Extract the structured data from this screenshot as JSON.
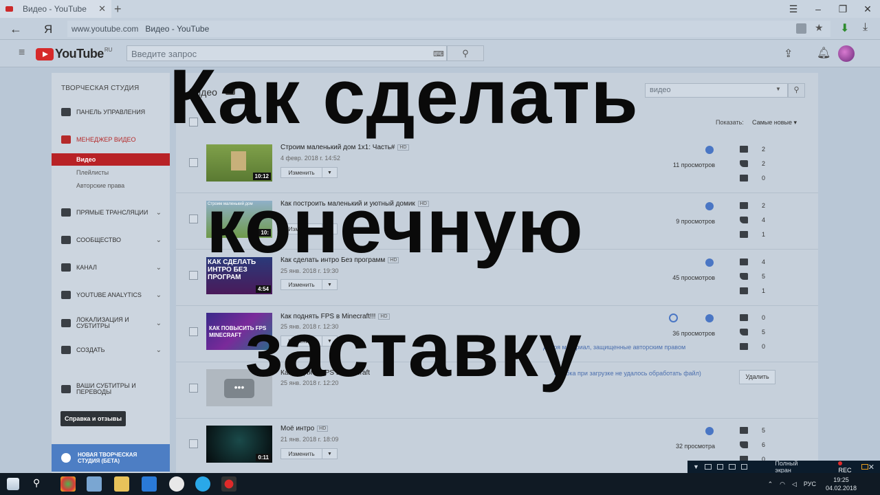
{
  "browser": {
    "tab_title": "Видео - YouTube",
    "url_host": "www.youtube.com",
    "url_title": "Видео - YouTube",
    "yandex_label": "Я"
  },
  "youtube": {
    "logo_text": "YouTube",
    "logo_region": "RU",
    "search_placeholder": "Введите запрос"
  },
  "sidebar": {
    "title": "ТВОРЧЕСКАЯ СТУДИЯ",
    "items": [
      {
        "label": "ПАНЕЛЬ УПРАВЛЕНИЯ"
      },
      {
        "label": "МЕНЕДЖЕР ВИДЕО"
      },
      {
        "label": "ПРЯМЫЕ ТРАНСЛЯЦИИ"
      },
      {
        "label": "СООБЩЕСТВО"
      },
      {
        "label": "КАНАЛ"
      },
      {
        "label": "YOUTUBE ANALYTICS"
      },
      {
        "label": "ЛОКАЛИЗАЦИЯ И СУБТИТРЫ"
      },
      {
        "label": "СОЗДАТЬ"
      },
      {
        "label": "ВАШИ СУБТИТРЫ И ПЕРЕВОДЫ"
      }
    ],
    "subitems": [
      "Видео",
      "Плейлисты",
      "Авторские права"
    ],
    "help_button": "Справка и отзывы",
    "new_studio": "НОВАЯ ТВОРЧЕСКАЯ СТУДИЯ (БЕТА)"
  },
  "main": {
    "title": "Видео",
    "count_badge": "9",
    "search_placeholder": "видео",
    "show_label": "Показать:",
    "sort_value": "Самые новые",
    "edit_label": "Изменить",
    "delete_label": "Удалить",
    "videos": [
      {
        "title": "Строим маленький дом 1х1: Часть#",
        "date": "4 февр. 2018 г. 14:52",
        "duration": "10:12",
        "views": "11 просмотров",
        "comments": "2",
        "likes": "2",
        "dislikes": "0"
      },
      {
        "title": "Как построить маленький и уютный домик",
        "date": "",
        "duration": "10:",
        "views": "9 просмотров",
        "comments": "2",
        "likes": "4",
        "dislikes": "1",
        "thumb_text": "Строим маленький дом"
      },
      {
        "title": "Как сделать интро Без программ",
        "date": "25 янв. 2018 г. 19:30",
        "duration": "4:54",
        "views": "45 просмотров",
        "comments": "4",
        "likes": "5",
        "dislikes": "1",
        "thumb_text": "КАК СДЕЛАТЬ ИНТРО БЕЗ ПРОГРАМ"
      },
      {
        "title": "Как поднять FPS в Minecraft!!!",
        "date": "25 янв. 2018 г. 12:30",
        "duration": "",
        "views": "36 просмотров",
        "comments": "0",
        "likes": "5",
        "dislikes": "0",
        "note": "деоря материал, защищенные авторским правом",
        "thumb_text": "КАК ПОВЫСИТЬ FPS MINECRAFT"
      },
      {
        "title": "Как поднять FPS в Minecraft",
        "date": "25 янв. 2018 г. 12:20",
        "duration": "",
        "views": "",
        "note": "ошибка при загрузке не удалось обработать файл)"
      },
      {
        "title": "Моё интро",
        "date": "21 янв. 2018 г. 18:09",
        "duration": "0:11",
        "views": "32 просмотра",
        "comments": "5",
        "likes": "6",
        "dislikes": "0"
      }
    ],
    "hd_label": "HD"
  },
  "overlay": {
    "line1": "Как сделать",
    "line2": "конечную",
    "line3": "заставку"
  },
  "recorder": {
    "fullscreen": "Полный экран",
    "rec": "REC"
  },
  "taskbar": {
    "lang": "РУС",
    "time": "19:25",
    "date": "04.02.2018"
  },
  "colors": {
    "accent_red": "#b82226",
    "youtube_red": "#d62a2a",
    "link_blue": "#4a76c4"
  }
}
